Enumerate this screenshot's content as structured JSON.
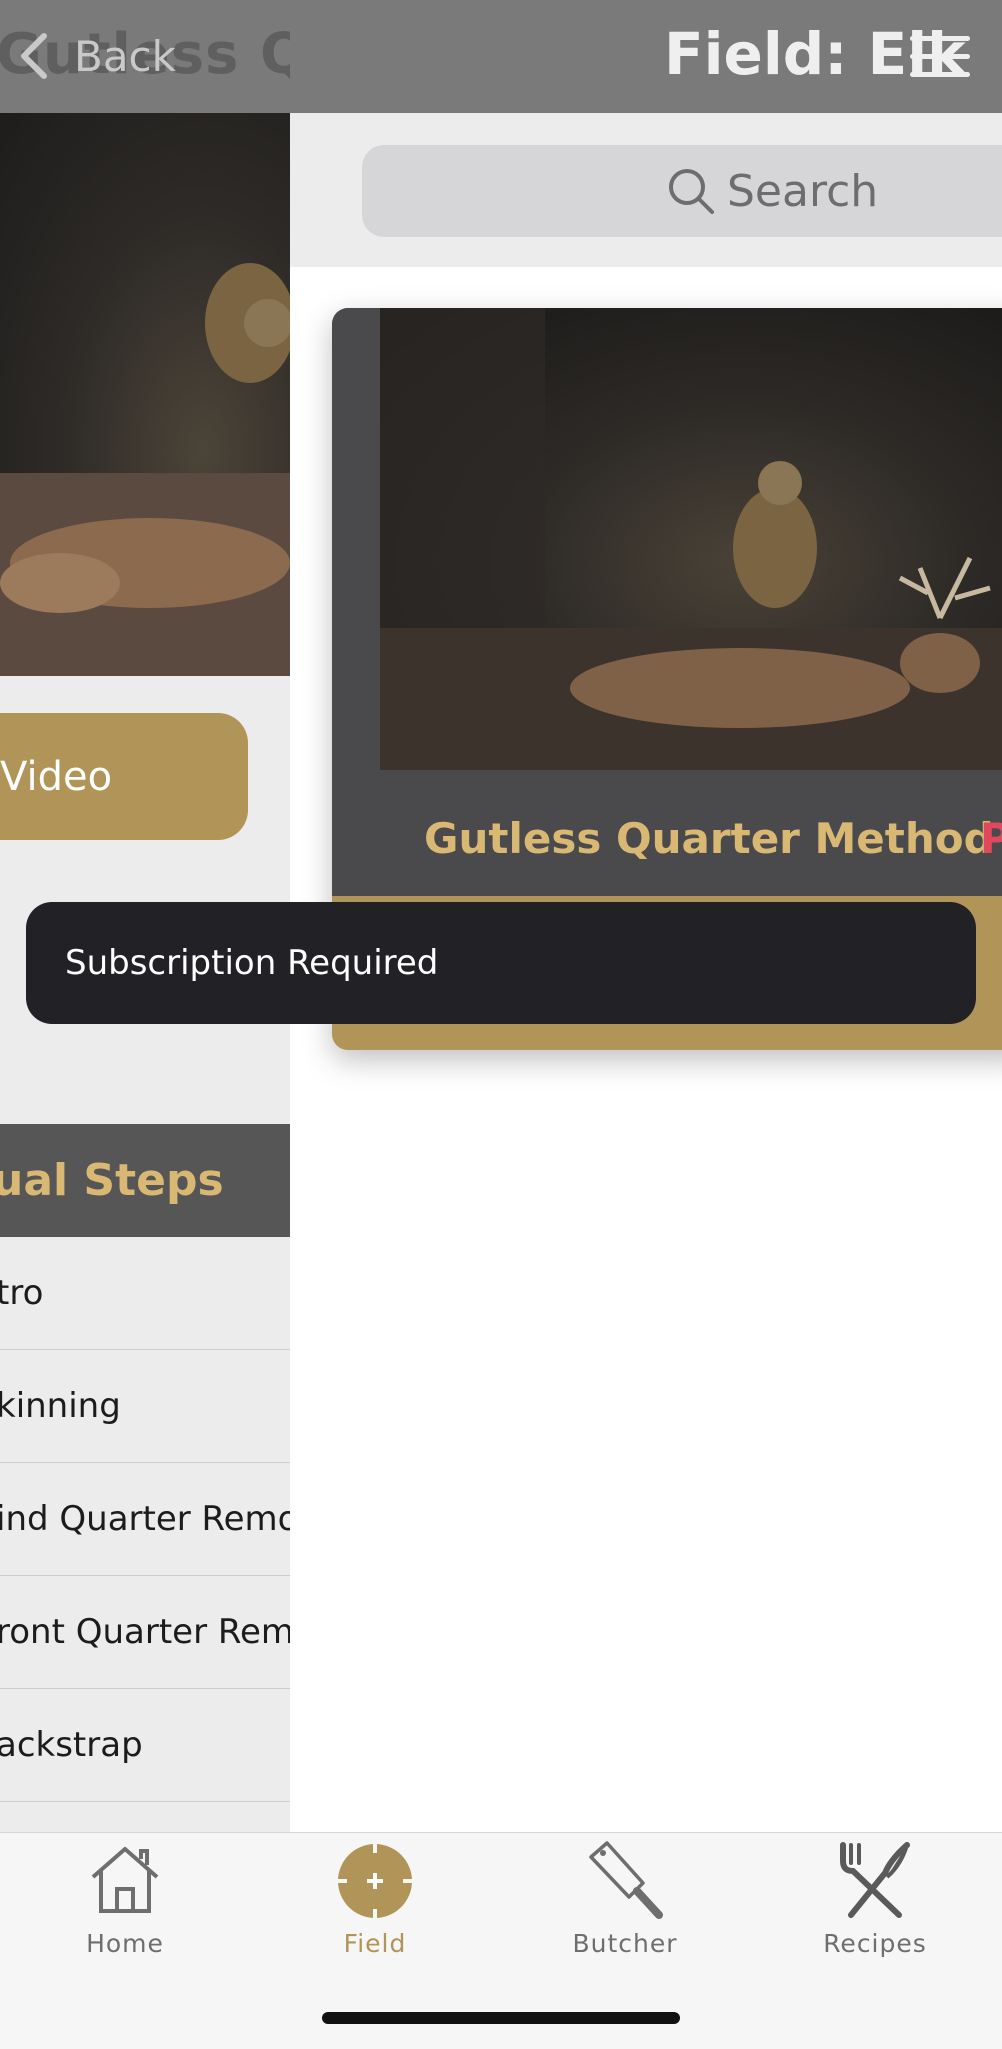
{
  "background_screen": {
    "title": "Gutless Qu",
    "back_label": "Back",
    "play_button_label": "Video",
    "steps_header": "ual Steps",
    "steps": [
      "tro",
      "kinning",
      "ind Quarter Remo",
      "ront Quarter Remo",
      "ackstrap"
    ]
  },
  "foreground": {
    "title": "Field: Elk",
    "search_placeholder": "Search",
    "card": {
      "title": "Gutless Quarter Method",
      "badge": "P"
    }
  },
  "toast": {
    "message": "Subscription Required"
  },
  "tab_bar": {
    "tabs": [
      {
        "label": "Home",
        "icon": "home-icon"
      },
      {
        "label": "Field",
        "icon": "field-crosshair-icon",
        "selected": true
      },
      {
        "label": "Butcher",
        "icon": "cleaver-icon"
      },
      {
        "label": "Recipes",
        "icon": "fork-knife-icon"
      }
    ]
  },
  "colors": {
    "accent_gold": "#b09458",
    "title_gold": "#d9b873",
    "badge_red": "#e0485e",
    "nav_gray": "#7a7a7a",
    "toast_bg": "#222226"
  }
}
